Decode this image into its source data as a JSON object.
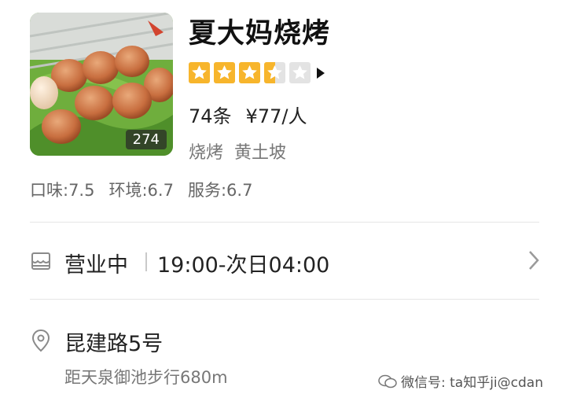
{
  "restaurant": {
    "name": "夏大妈烧烤",
    "rating": 3.5,
    "rating_max": 5,
    "review_count": "74条",
    "price_per_person": "¥77/人",
    "category": "烧烤",
    "area": "黄土坡",
    "photo_count": "274"
  },
  "scores": {
    "taste": "口味:7.5",
    "environment": "环境:6.7",
    "service": "服务:6.7"
  },
  "hours": {
    "status": "营业中",
    "time": "19:00-次日04:00"
  },
  "location": {
    "address": "昆建路5号",
    "distance": "距天泉御池步行680m"
  },
  "watermark": {
    "text": "微信号: ta知乎ji@cdan"
  },
  "colors": {
    "star_fill": "#f7b52c",
    "star_empty": "#e3e3e3"
  }
}
